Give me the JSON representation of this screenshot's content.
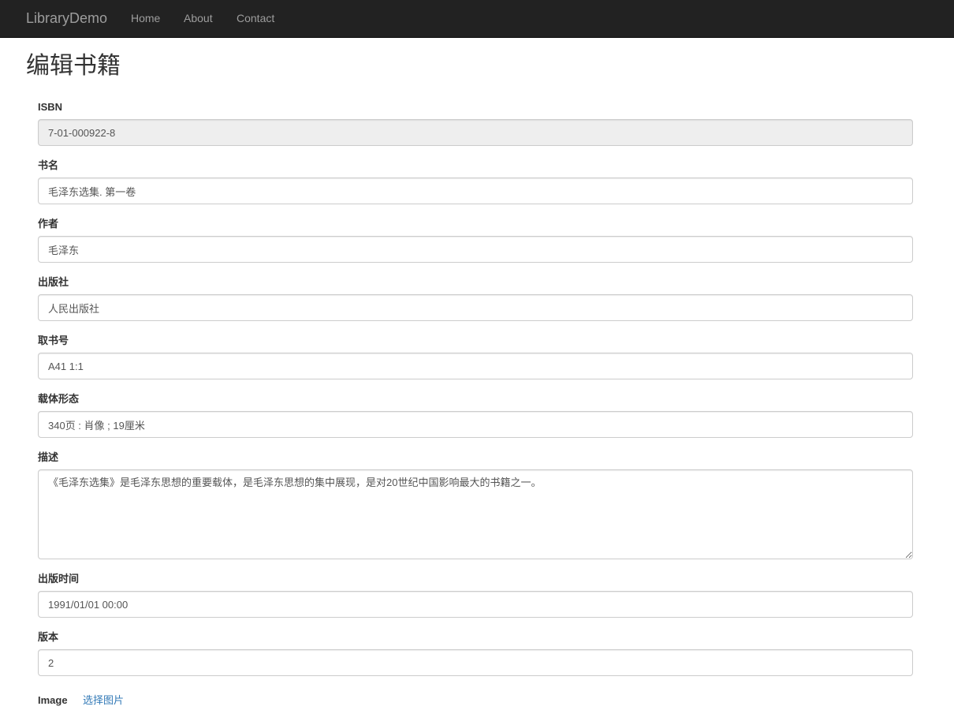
{
  "navbar": {
    "brand": "LibraryDemo",
    "links": [
      "Home",
      "About",
      "Contact"
    ]
  },
  "page": {
    "title": "编辑书籍"
  },
  "form": {
    "isbn": {
      "label": "ISBN",
      "value": "7-01-000922-8"
    },
    "title": {
      "label": "书名",
      "value": "毛泽东选集. 第一卷"
    },
    "author": {
      "label": "作者",
      "value": "毛泽东"
    },
    "publisher": {
      "label": "出版社",
      "value": "人民出版社"
    },
    "call_number": {
      "label": "取书号",
      "value": "A41 1:1"
    },
    "physical": {
      "label": "载体形态",
      "value": "340页 : 肖像 ; 19厘米"
    },
    "description": {
      "label": "描述",
      "value": "《毛泽东选集》是毛泽东思想的重要载体，是毛泽东思想的集中展现，是对20世纪中国影响最大的书籍之一。"
    },
    "publish_date": {
      "label": "出版时间",
      "value": "1991/01/01 00:00"
    },
    "edition": {
      "label": "版本",
      "value": "2"
    },
    "image": {
      "label": "Image",
      "link": "选择图片"
    }
  }
}
